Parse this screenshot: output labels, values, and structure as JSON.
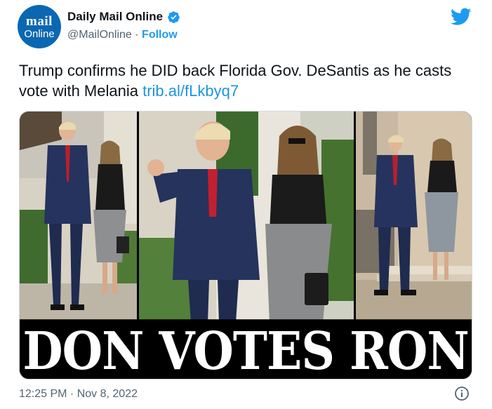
{
  "account": {
    "avatar_line1": "mail",
    "avatar_line2": "Online",
    "display_name": "Daily Mail Online",
    "handle": "@MailOnline",
    "separator": " · ",
    "follow_label": "Follow"
  },
  "tweet": {
    "text": "Trump confirms he DID back Florida Gov. DeSantis as he casts vote with Melania",
    "link": "trib.al/fLkbyq7"
  },
  "media": {
    "headline": "DON VOTES RON"
  },
  "footer": {
    "timestamp": "12:25 PM · Nov 8, 2022"
  },
  "icons": {
    "brand": "twitter-bird-icon",
    "verified": "verified-badge-icon",
    "info": "info-icon"
  },
  "colors": {
    "link": "#1b95e0",
    "brand": "#1d9bf0",
    "avatar": "#0b67b2",
    "text": "#0f1419",
    "muted": "#536471"
  }
}
